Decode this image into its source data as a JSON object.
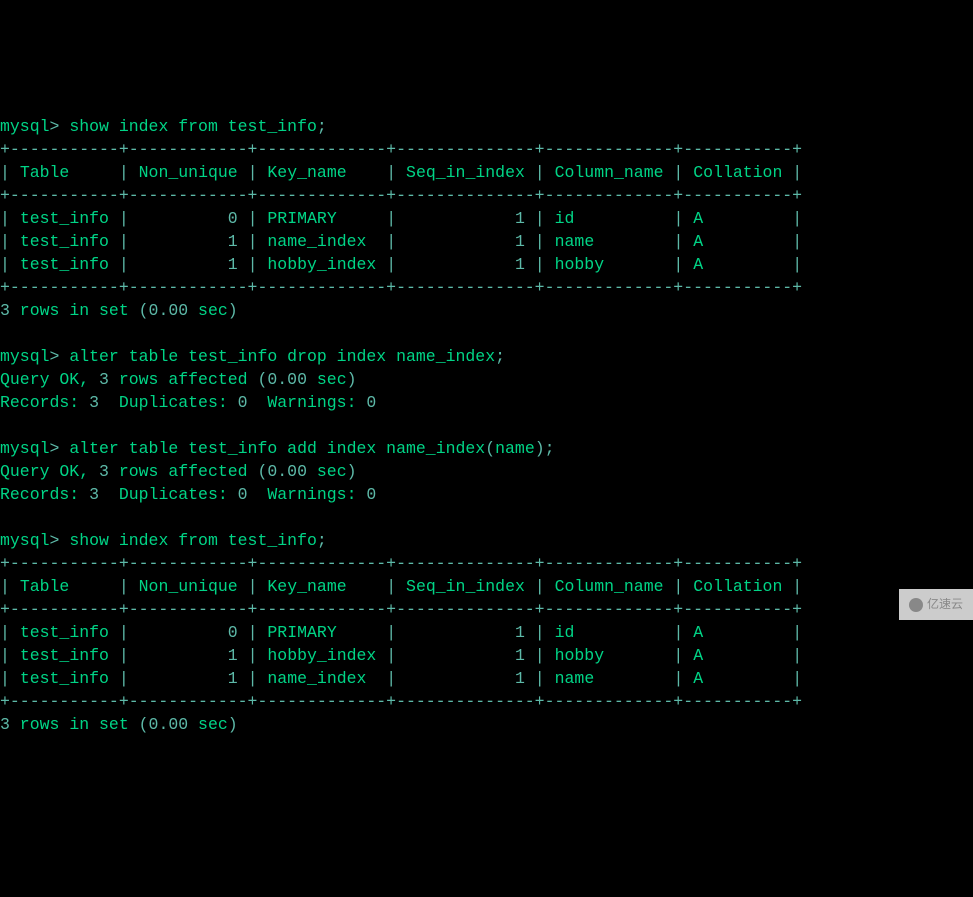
{
  "prompt": "mysql",
  "prompt_arrow": ">",
  "commands": {
    "show1": "show index from test_info",
    "alter_drop": "alter table test_info drop index name_index",
    "alter_add_pre": "alter table test_info add index name_index",
    "alter_add_paren_open": "(",
    "alter_add_arg": "name",
    "alter_add_paren_close": ")",
    "show2": "show index from test_info"
  },
  "semicolon": ";",
  "border": "+-----------+------------+-------------+--------------+-------------+-----------+",
  "headers": {
    "table": "Table",
    "non_unique": "Non_unique",
    "key_name": "Key_name",
    "seq": "Seq_in_index",
    "col": "Column_name",
    "collation": "Collation"
  },
  "table1": [
    {
      "table": "test_info",
      "non_unique": "0",
      "key_name": "PRIMARY",
      "seq": "1",
      "col": "id",
      "collation": "A"
    },
    {
      "table": "test_info",
      "non_unique": "1",
      "key_name": "name_index",
      "seq": "1",
      "col": "name",
      "collation": "A"
    },
    {
      "table": "test_info",
      "non_unique": "1",
      "key_name": "hobby_index",
      "seq": "1",
      "col": "hobby",
      "collation": "A"
    }
  ],
  "table2": [
    {
      "table": "test_info",
      "non_unique": "0",
      "key_name": "PRIMARY",
      "seq": "1",
      "col": "id",
      "collation": "A"
    },
    {
      "table": "test_info",
      "non_unique": "1",
      "key_name": "hobby_index",
      "seq": "1",
      "col": "hobby",
      "collation": "A"
    },
    {
      "table": "test_info",
      "non_unique": "1",
      "key_name": "name_index",
      "seq": "1",
      "col": "name",
      "collation": "A"
    }
  ],
  "result": {
    "rows_count": "3",
    "rows_text": " rows in set ",
    "time_open": "(",
    "time_val": "0.00",
    "time_sec": " sec",
    "time_close": ")"
  },
  "query_ok": {
    "text": "Query OK, ",
    "rows": "3",
    "affected": " rows affected ",
    "time_open": "(",
    "time_val": "0.00",
    "time_sec": " sec",
    "time_close": ")"
  },
  "records_line": {
    "records": "Records: ",
    "records_n": "3",
    "dup": "  Duplicates: ",
    "dup_n": "0",
    "warn": "  Warnings: ",
    "warn_n": "0"
  },
  "pipe": "|",
  "watermark": "亿速云"
}
